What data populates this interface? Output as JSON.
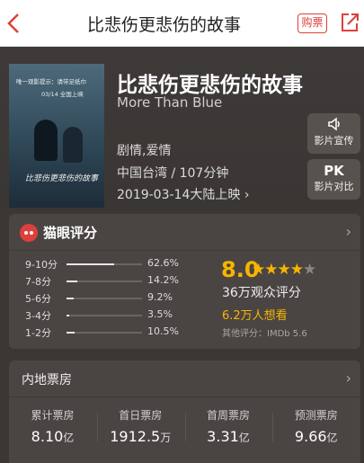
{
  "header": {
    "title": "比悲伤更悲伤的故事",
    "buy_label": "购票",
    "colors": {
      "accent": "#dd403b"
    }
  },
  "film": {
    "title": "比悲伤更悲伤的故事",
    "english_title": "More Than Blue",
    "genres": "剧情,爱情",
    "region_duration": "中国台湾 / 107分钟",
    "release": "2019-03-14大陆上映",
    "poster": {
      "tagline": "唯一观影提示：请带足纸巾",
      "date": "03/14 全国上映"
    }
  },
  "side_buttons": [
    {
      "icon": "megaphone-icon",
      "label": "影片宣传"
    },
    {
      "icon_text": "PK",
      "label": "影片对比"
    }
  ],
  "rating": {
    "header": "猫眼评分",
    "score": "8.0",
    "stars_filled": 4,
    "stars_total": 5,
    "score_count": "36万观众评分",
    "want_to_see": "6.2万人想看",
    "other_rating": "其他评分：IMDb 5.6",
    "distribution": [
      {
        "label": "9-10分",
        "percent": "62.6%",
        "value": 62.6
      },
      {
        "label": "7-8分",
        "percent": "14.2%",
        "value": 14.2
      },
      {
        "label": "5-6分",
        "percent": "9.2%",
        "value": 9.2
      },
      {
        "label": "3-4分",
        "percent": "3.5%",
        "value": 3.5
      },
      {
        "label": "1-2分",
        "percent": "10.5%",
        "value": 10.5
      }
    ]
  },
  "box_office": {
    "header": "内地票房",
    "stats": [
      {
        "label": "累计票房",
        "value": "8.10",
        "unit": "亿"
      },
      {
        "label": "首日票房",
        "value": "1912.5",
        "unit": "万"
      },
      {
        "label": "首周票房",
        "value": "3.31",
        "unit": "亿"
      },
      {
        "label": "预测票房",
        "value": "9.66",
        "unit": "亿"
      }
    ]
  }
}
